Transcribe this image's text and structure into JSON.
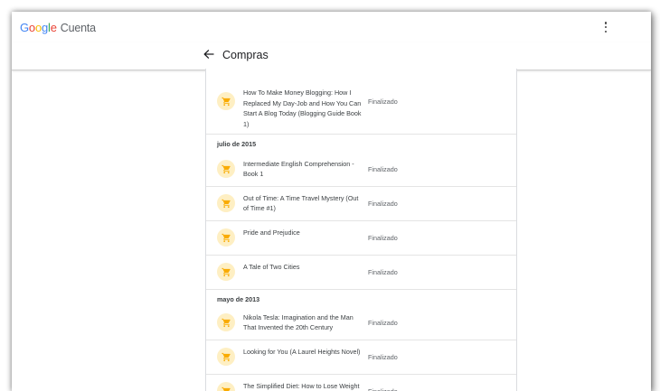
{
  "header": {
    "logo_parts": [
      "G",
      "o",
      "o",
      "g",
      "l",
      "e"
    ],
    "app_name": "Cuenta"
  },
  "subheader": {
    "title": "Compras"
  },
  "colors": {
    "icon_bg": "#feefc3",
    "icon_fg": "#f9ab00"
  },
  "icons": {
    "back": "arrow-left-icon",
    "menu": "more-vert-icon",
    "item": "shopping-cart-icon"
  },
  "purchases": {
    "status_label": "Finalizado",
    "sections": [
      {
        "heading": "",
        "items": [
          {
            "title": "How To Make Money Blogging: How I Replaced My Day-Job and How You Can Start A Blog Today (Blogging Guide Book 1)",
            "status": "Finalizado"
          }
        ]
      },
      {
        "heading": "julio de 2015",
        "items": [
          {
            "title": "Intermediate English Comprehension - Book 1",
            "status": "Finalizado"
          },
          {
            "title": "Out of Time: A Time Travel Mystery (Out of Time #1)",
            "status": "Finalizado"
          },
          {
            "title": "Pride and Prejudice",
            "status": "Finalizado"
          },
          {
            "title": "A Tale of Two Cities",
            "status": "Finalizado"
          }
        ]
      },
      {
        "heading": "mayo de 2013",
        "items": [
          {
            "title": "Nikola Tesla: Imagination and the Man That Invented the 20th Century",
            "status": "Finalizado"
          },
          {
            "title": "Looking for You (A Laurel Heights Novel)",
            "status": "Finalizado"
          },
          {
            "title": "The Simplified Diet: How to Lose Weight Without Counting Calories!",
            "status": "Finalizado"
          }
        ]
      }
    ]
  }
}
